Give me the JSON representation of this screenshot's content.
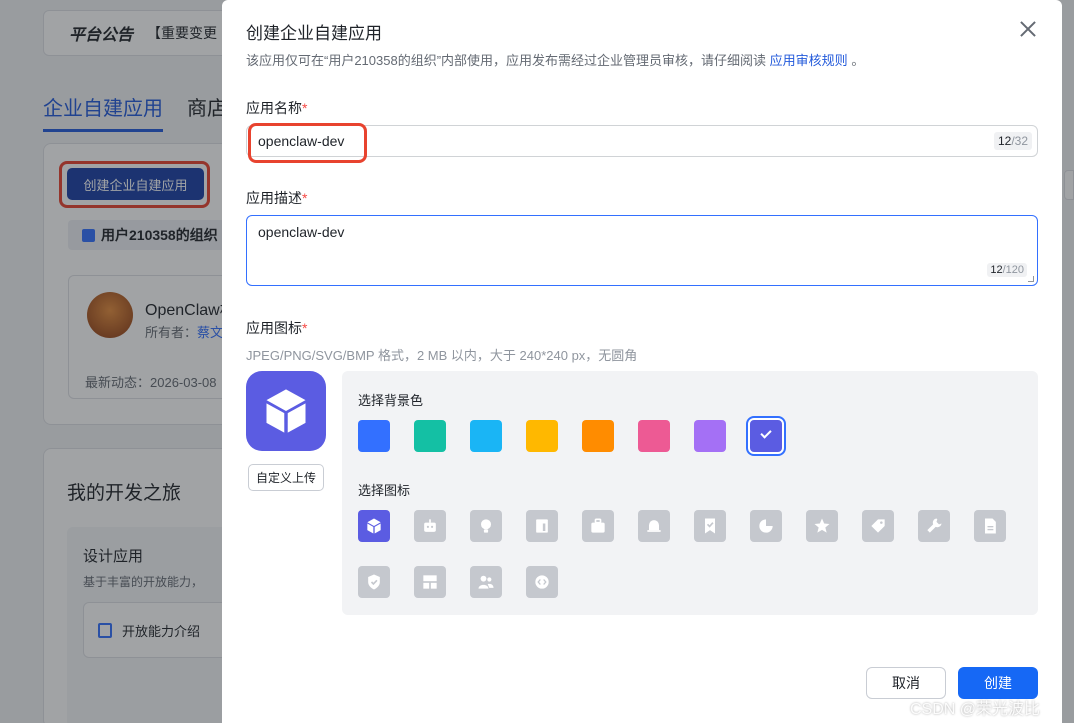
{
  "background": {
    "notice": {
      "title": "平台公告",
      "text": "【重要变更"
    },
    "tabs": [
      "企业自建应用",
      "商店"
    ],
    "create_button": "创建企业自建应用",
    "org_name": "用户210358的组织",
    "app_card": {
      "name": "OpenClaw机",
      "owner_label": "所有者：",
      "owner": "蔡文",
      "latest": "最新动态：2026-03-08"
    },
    "journey": {
      "title": "我的开发之旅",
      "design_title": "设计应用",
      "design_sub": "基于丰富的开放能力，",
      "open_intro": "开放能力介绍"
    }
  },
  "modal": {
    "title": "创建企业自建应用",
    "description": "该应用仅可在“用户210358的组织”内部使用，应用发布需经过企业管理员审核，请仔细阅读",
    "rules_link": "应用审核规则",
    "description_end": "。",
    "name_field": {
      "label": "应用名称",
      "required": "*",
      "value": "openclaw-dev",
      "count": "12",
      "max": "/32"
    },
    "desc_field": {
      "label": "应用描述",
      "required": "*",
      "value": "openclaw-dev",
      "count": "12",
      "max": "/120"
    },
    "icon_field": {
      "label": "应用图标",
      "required": "*",
      "hint": "JPEG/PNG/SVG/BMP 格式，2 MB 以内，大于 240*240 px，无圆角",
      "upload_label": "自定义上传",
      "bg_label": "选择背景色",
      "icon_label": "选择图标",
      "colors": [
        "#3370ff",
        "#14c0a4",
        "#1ab5f5",
        "#ffb800",
        "#ff8c00",
        "#ed5a94",
        "#a470f5",
        "#5b5ce2"
      ],
      "selected_color_index": 7,
      "icons": [
        "cube-icon",
        "robot-icon",
        "bulb-icon",
        "chart-icon",
        "briefcase-icon",
        "bell-icon",
        "bookmark-check-icon",
        "pie-icon",
        "star-icon",
        "tag-icon",
        "wrench-icon",
        "document-icon",
        "shield-check-icon",
        "layout-icon",
        "users-icon",
        "code-icon"
      ],
      "selected_icon_index": 0
    },
    "cancel_label": "取消",
    "create_label": "创建"
  },
  "watermark": "CSDN @荣光波比"
}
